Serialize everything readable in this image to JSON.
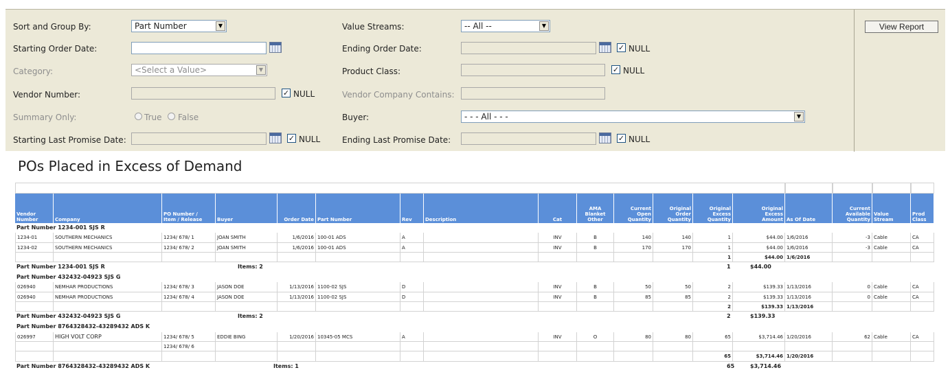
{
  "params": {
    "sort_group_label": "Sort and Group By:",
    "sort_group_value": "Part Number",
    "value_streams_label": "Value Streams:",
    "value_streams_value": "-- All --",
    "starting_order_date_label": "Starting Order Date:",
    "starting_order_date_value": "",
    "ending_order_date_label": "Ending Order Date:",
    "category_label": "Category:",
    "category_value": "<Select a Value>",
    "product_class_label": "Product Class:",
    "vendor_number_label": "Vendor Number:",
    "vendor_company_label": "Vendor Company Contains:",
    "summary_only_label": "Summary Only:",
    "true_label": "True",
    "false_label": "False",
    "buyer_label": "Buyer:",
    "buyer_value": "- - - All - - -",
    "starting_last_promise_label": "Starting Last Promise Date:",
    "ending_last_promise_label": "Ending Last Promise Date:",
    "null_label": "NULL",
    "check_mark": "✓",
    "view_report": "View Report"
  },
  "report": {
    "title": "POs Placed in Excess of Demand",
    "columns": [
      [
        "Vendor",
        "Number"
      ],
      [
        "Company"
      ],
      [
        "PO Number /",
        "Item / Release"
      ],
      [
        "Buyer"
      ],
      [
        "Order Date"
      ],
      [
        "Part Number"
      ],
      [
        "Rev"
      ],
      [
        "Description"
      ],
      [
        "Cat"
      ],
      [
        "AMA",
        "Blanket",
        "Other"
      ],
      [
        "Current",
        "Open",
        "Quantity"
      ],
      [
        "Original",
        "Order",
        "Quantity"
      ],
      [
        "Original",
        "Excess",
        "Quantity"
      ],
      [
        "Original",
        "Excess",
        "Amount"
      ],
      [
        "As Of Date"
      ],
      [
        "Current",
        "Available",
        "Quantity"
      ],
      [
        "Value",
        "Stream"
      ],
      [
        "Prod",
        "Class"
      ]
    ],
    "groups": [
      {
        "header": "Part Number  1234-001     SJS  R",
        "rows": [
          [
            "1234-01",
            "SOUTHERN MECHANICS",
            "1234/ 678/ 1",
            "JOAN SMITH",
            "1/6/2016",
            "100-01 ADS",
            "A",
            "",
            "INV",
            "B",
            "140",
            "140",
            "1",
            "$44.00",
            "1/6/2016",
            "-3",
            "Cable",
            "CA"
          ],
          [
            "1234-02",
            "SOUTHERN MECHANICS",
            "1234/ 678/ 2",
            "JOAN SMITH",
            "1/6/2016",
            "100-01 ADS",
            "A",
            "",
            "INV",
            "B",
            "170",
            "170",
            "1",
            "$44.00",
            "1/6/2016",
            "-3",
            "Cable",
            "CA"
          ]
        ],
        "subtotal": {
          "qty": "1",
          "amount": "$44.00",
          "date": "1/6/2016"
        },
        "footer": {
          "label": "Part Number  1234-001     SJS  R",
          "items": "Items: 2",
          "qty": "1",
          "amount": "$44.00"
        }
      },
      {
        "header": "Part Number  432432-04923 SJS  G",
        "rows": [
          [
            "026940",
            "NEMHAR PRODUCTIONS",
            "1234/ 678/ 3",
            "JASON DOE",
            "1/13/2016",
            "1100-02 SJS",
            "D",
            "",
            "INV",
            "B",
            "50",
            "50",
            "2",
            "$139.33",
            "1/13/2016",
            "0",
            "Cable",
            "CA"
          ],
          [
            "026940",
            "NEMHAR PRODUCTIONS",
            "1234/ 678/ 4",
            "JASON DOE",
            "1/13/2016",
            "1100-02 SJS",
            "D",
            "",
            "INV",
            "B",
            "85",
            "85",
            "2",
            "$139.33",
            "1/13/2016",
            "0",
            "Cable",
            "CA"
          ]
        ],
        "subtotal": {
          "qty": "2",
          "amount": "$139.33",
          "date": "1/13/2016"
        },
        "footer": {
          "label": "Part Number  432432-04923 SJS  G",
          "items": "Items: 2",
          "qty": "2",
          "amount": "$139.33"
        }
      },
      {
        "header": "Part Number  8764328432-43289432 ADS  K",
        "rows": [
          [
            "026997",
            "HIGH VOLT CORP",
            "1234/ 678/ 5",
            "EDDIE BING",
            "1/20/2016",
            "10345-05 MCS",
            "A",
            "",
            "INV",
            "O",
            "80",
            "80",
            "65",
            "$3,714.46",
            "1/20/2016",
            "62",
            "Cable",
            "CA"
          ],
          [
            "",
            "",
            "1234/ 678/ 6",
            "",
            "",
            "",
            "",
            "",
            "",
            "",
            "",
            "",
            "",
            "",
            "",
            "",
            "",
            ""
          ]
        ],
        "subtotal": {
          "qty": "65",
          "amount": "$3,714.46",
          "date": "1/20/2016"
        },
        "footer": {
          "label": "Part Number  8764328432-43289432 ADS  K",
          "items": "Items: 1",
          "qty": "65",
          "amount": "$3,714.46"
        }
      }
    ]
  }
}
